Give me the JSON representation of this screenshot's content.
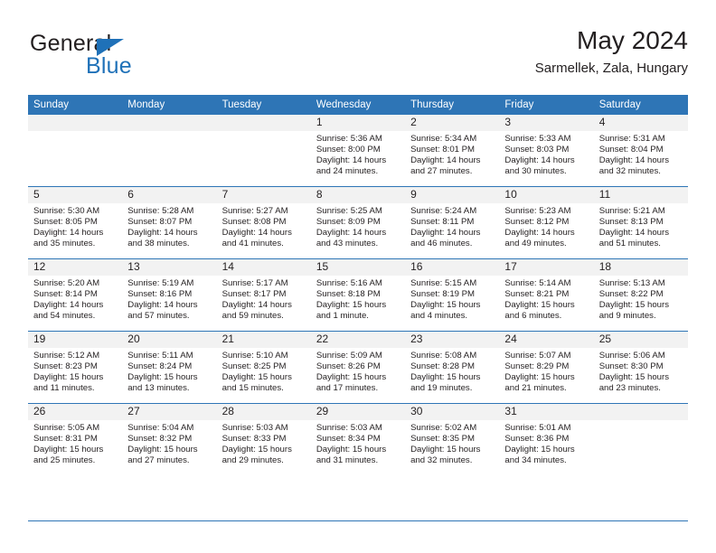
{
  "brand": {
    "name_top": "General",
    "name_bottom": "Blue",
    "triangle_icon": "blue-triangle-icon",
    "color_primary": "#1f71b8",
    "color_text": "#231f20"
  },
  "header": {
    "title": "May 2024",
    "subtitle": "Sarmellek, Zala, Hungary"
  },
  "theme": {
    "header_bg": "#2e75b6",
    "header_text": "#ffffff",
    "daynum_bg": "#f2f2f2",
    "cell_bg": "#ffffff",
    "rule_color": "#2e75b6"
  },
  "weekday_headers": [
    "Sunday",
    "Monday",
    "Tuesday",
    "Wednesday",
    "Thursday",
    "Friday",
    "Saturday"
  ],
  "labels": {
    "sunrise_prefix": "Sunrise:",
    "sunset_prefix": "Sunset:",
    "daylight_prefix": "Daylight:"
  },
  "weeks": [
    [
      {
        "day": "",
        "line1": "",
        "line2": "",
        "line3": "",
        "line4": "",
        "empty": true
      },
      {
        "day": "",
        "line1": "",
        "line2": "",
        "line3": "",
        "line4": "",
        "empty": true
      },
      {
        "day": "",
        "line1": "",
        "line2": "",
        "line3": "",
        "line4": "",
        "empty": true
      },
      {
        "day": "1",
        "line1": "Sunrise: 5:36 AM",
        "line2": "Sunset: 8:00 PM",
        "line3": "Daylight: 14 hours",
        "line4": "and 24 minutes.",
        "empty": false
      },
      {
        "day": "2",
        "line1": "Sunrise: 5:34 AM",
        "line2": "Sunset: 8:01 PM",
        "line3": "Daylight: 14 hours",
        "line4": "and 27 minutes.",
        "empty": false
      },
      {
        "day": "3",
        "line1": "Sunrise: 5:33 AM",
        "line2": "Sunset: 8:03 PM",
        "line3": "Daylight: 14 hours",
        "line4": "and 30 minutes.",
        "empty": false
      },
      {
        "day": "4",
        "line1": "Sunrise: 5:31 AM",
        "line2": "Sunset: 8:04 PM",
        "line3": "Daylight: 14 hours",
        "line4": "and 32 minutes.",
        "empty": false
      }
    ],
    [
      {
        "day": "5",
        "line1": "Sunrise: 5:30 AM",
        "line2": "Sunset: 8:05 PM",
        "line3": "Daylight: 14 hours",
        "line4": "and 35 minutes.",
        "empty": false
      },
      {
        "day": "6",
        "line1": "Sunrise: 5:28 AM",
        "line2": "Sunset: 8:07 PM",
        "line3": "Daylight: 14 hours",
        "line4": "and 38 minutes.",
        "empty": false
      },
      {
        "day": "7",
        "line1": "Sunrise: 5:27 AM",
        "line2": "Sunset: 8:08 PM",
        "line3": "Daylight: 14 hours",
        "line4": "and 41 minutes.",
        "empty": false
      },
      {
        "day": "8",
        "line1": "Sunrise: 5:25 AM",
        "line2": "Sunset: 8:09 PM",
        "line3": "Daylight: 14 hours",
        "line4": "and 43 minutes.",
        "empty": false
      },
      {
        "day": "9",
        "line1": "Sunrise: 5:24 AM",
        "line2": "Sunset: 8:11 PM",
        "line3": "Daylight: 14 hours",
        "line4": "and 46 minutes.",
        "empty": false
      },
      {
        "day": "10",
        "line1": "Sunrise: 5:23 AM",
        "line2": "Sunset: 8:12 PM",
        "line3": "Daylight: 14 hours",
        "line4": "and 49 minutes.",
        "empty": false
      },
      {
        "day": "11",
        "line1": "Sunrise: 5:21 AM",
        "line2": "Sunset: 8:13 PM",
        "line3": "Daylight: 14 hours",
        "line4": "and 51 minutes.",
        "empty": false
      }
    ],
    [
      {
        "day": "12",
        "line1": "Sunrise: 5:20 AM",
        "line2": "Sunset: 8:14 PM",
        "line3": "Daylight: 14 hours",
        "line4": "and 54 minutes.",
        "empty": false
      },
      {
        "day": "13",
        "line1": "Sunrise: 5:19 AM",
        "line2": "Sunset: 8:16 PM",
        "line3": "Daylight: 14 hours",
        "line4": "and 57 minutes.",
        "empty": false
      },
      {
        "day": "14",
        "line1": "Sunrise: 5:17 AM",
        "line2": "Sunset: 8:17 PM",
        "line3": "Daylight: 14 hours",
        "line4": "and 59 minutes.",
        "empty": false
      },
      {
        "day": "15",
        "line1": "Sunrise: 5:16 AM",
        "line2": "Sunset: 8:18 PM",
        "line3": "Daylight: 15 hours",
        "line4": "and 1 minute.",
        "empty": false
      },
      {
        "day": "16",
        "line1": "Sunrise: 5:15 AM",
        "line2": "Sunset: 8:19 PM",
        "line3": "Daylight: 15 hours",
        "line4": "and 4 minutes.",
        "empty": false
      },
      {
        "day": "17",
        "line1": "Sunrise: 5:14 AM",
        "line2": "Sunset: 8:21 PM",
        "line3": "Daylight: 15 hours",
        "line4": "and 6 minutes.",
        "empty": false
      },
      {
        "day": "18",
        "line1": "Sunrise: 5:13 AM",
        "line2": "Sunset: 8:22 PM",
        "line3": "Daylight: 15 hours",
        "line4": "and 9 minutes.",
        "empty": false
      }
    ],
    [
      {
        "day": "19",
        "line1": "Sunrise: 5:12 AM",
        "line2": "Sunset: 8:23 PM",
        "line3": "Daylight: 15 hours",
        "line4": "and 11 minutes.",
        "empty": false
      },
      {
        "day": "20",
        "line1": "Sunrise: 5:11 AM",
        "line2": "Sunset: 8:24 PM",
        "line3": "Daylight: 15 hours",
        "line4": "and 13 minutes.",
        "empty": false
      },
      {
        "day": "21",
        "line1": "Sunrise: 5:10 AM",
        "line2": "Sunset: 8:25 PM",
        "line3": "Daylight: 15 hours",
        "line4": "and 15 minutes.",
        "empty": false
      },
      {
        "day": "22",
        "line1": "Sunrise: 5:09 AM",
        "line2": "Sunset: 8:26 PM",
        "line3": "Daylight: 15 hours",
        "line4": "and 17 minutes.",
        "empty": false
      },
      {
        "day": "23",
        "line1": "Sunrise: 5:08 AM",
        "line2": "Sunset: 8:28 PM",
        "line3": "Daylight: 15 hours",
        "line4": "and 19 minutes.",
        "empty": false
      },
      {
        "day": "24",
        "line1": "Sunrise: 5:07 AM",
        "line2": "Sunset: 8:29 PM",
        "line3": "Daylight: 15 hours",
        "line4": "and 21 minutes.",
        "empty": false
      },
      {
        "day": "25",
        "line1": "Sunrise: 5:06 AM",
        "line2": "Sunset: 8:30 PM",
        "line3": "Daylight: 15 hours",
        "line4": "and 23 minutes.",
        "empty": false
      }
    ],
    [
      {
        "day": "26",
        "line1": "Sunrise: 5:05 AM",
        "line2": "Sunset: 8:31 PM",
        "line3": "Daylight: 15 hours",
        "line4": "and 25 minutes.",
        "empty": false
      },
      {
        "day": "27",
        "line1": "Sunrise: 5:04 AM",
        "line2": "Sunset: 8:32 PM",
        "line3": "Daylight: 15 hours",
        "line4": "and 27 minutes.",
        "empty": false
      },
      {
        "day": "28",
        "line1": "Sunrise: 5:03 AM",
        "line2": "Sunset: 8:33 PM",
        "line3": "Daylight: 15 hours",
        "line4": "and 29 minutes.",
        "empty": false
      },
      {
        "day": "29",
        "line1": "Sunrise: 5:03 AM",
        "line2": "Sunset: 8:34 PM",
        "line3": "Daylight: 15 hours",
        "line4": "and 31 minutes.",
        "empty": false
      },
      {
        "day": "30",
        "line1": "Sunrise: 5:02 AM",
        "line2": "Sunset: 8:35 PM",
        "line3": "Daylight: 15 hours",
        "line4": "and 32 minutes.",
        "empty": false
      },
      {
        "day": "31",
        "line1": "Sunrise: 5:01 AM",
        "line2": "Sunset: 8:36 PM",
        "line3": "Daylight: 15 hours",
        "line4": "and 34 minutes.",
        "empty": false
      },
      {
        "day": "",
        "line1": "",
        "line2": "",
        "line3": "",
        "line4": "",
        "empty": true
      }
    ]
  ]
}
